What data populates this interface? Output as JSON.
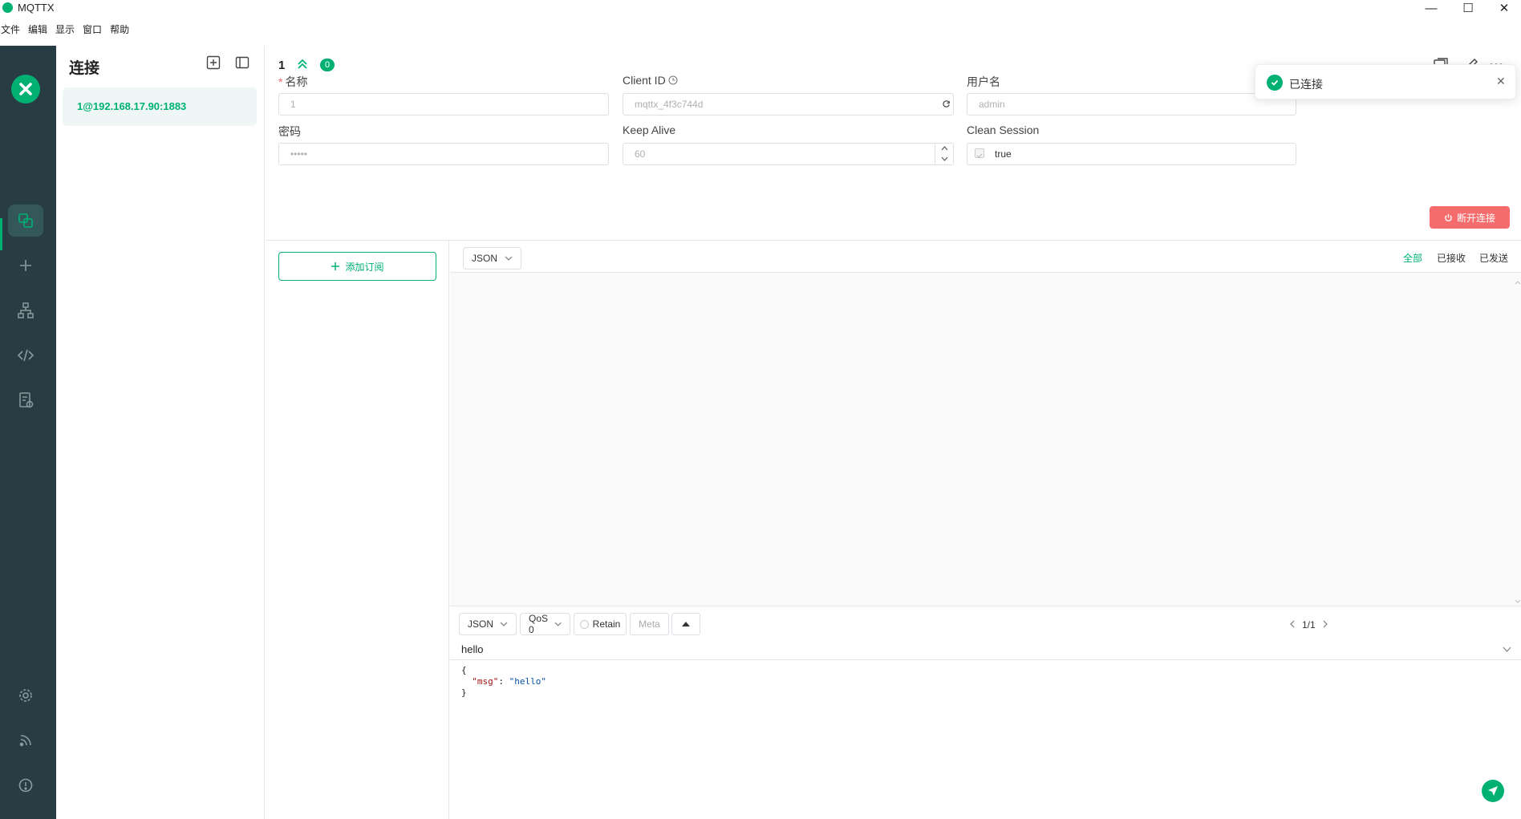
{
  "window": {
    "title": "MQTTX",
    "minimize": "—",
    "maximize": "☐",
    "close": "✕"
  },
  "menu": [
    "文件",
    "编辑",
    "显示",
    "窗口",
    "帮助"
  ],
  "connections": {
    "title": "连接",
    "items": [
      {
        "label": "1@192.168.17.90:1883"
      }
    ]
  },
  "header": {
    "name": "1",
    "received_count": "0"
  },
  "form": {
    "name_label": "名称",
    "name_value": "1",
    "client_id_label": "Client ID",
    "client_id_value": "mqttx_4f3c744d",
    "username_label": "用户名",
    "username_value": "admin",
    "password_label": "密码",
    "password_value": "•••••",
    "keepalive_label": "Keep Alive",
    "keepalive_value": "60",
    "clean_session_label": "Clean Session",
    "clean_session_value": "true"
  },
  "disconnect_label": "断开连接",
  "add_subscription_label": "添加订阅",
  "messages": {
    "format": "JSON",
    "filters": {
      "all": "全部",
      "received": "已接收",
      "sent": "已发送"
    }
  },
  "publish": {
    "format": "JSON",
    "qos": "QoS 0",
    "retain": "Retain",
    "meta": "Meta",
    "page": "1/1",
    "topic": "hello",
    "payload_open": "{",
    "payload_key": "\"msg\"",
    "payload_colon": ": ",
    "payload_value": "\"hello\"",
    "payload_close": "}"
  },
  "toast": {
    "message": "已连接"
  },
  "colors": {
    "accent": "#00b173",
    "rail": "#283d43",
    "danger": "#f56c6c"
  }
}
